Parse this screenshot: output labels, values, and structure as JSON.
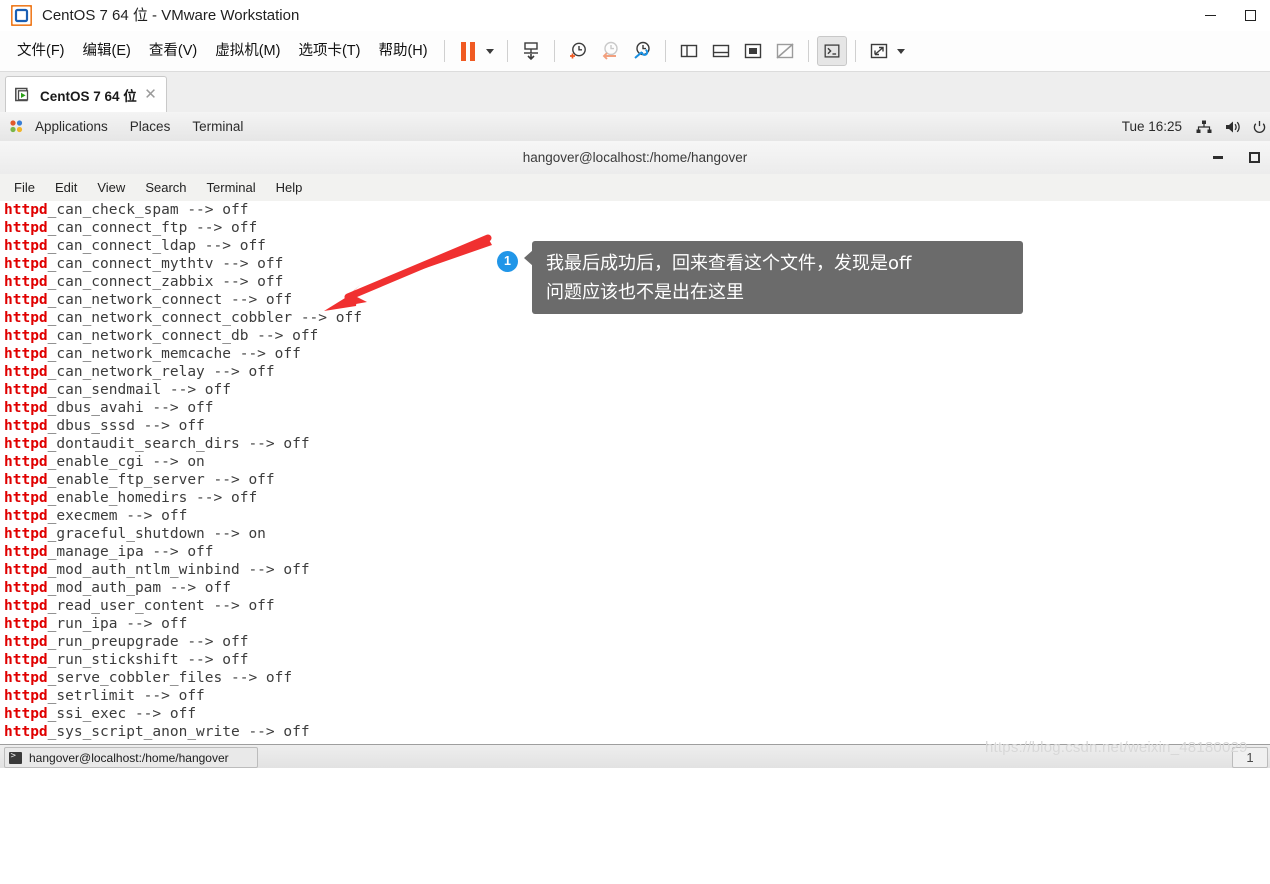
{
  "window": {
    "title": "CentOS 7 64 位 - VMware Workstation",
    "logo_icon": "vmware-logo-icon",
    "controls": [
      {
        "name": "minimize-button",
        "icon": "minimize-icon"
      },
      {
        "name": "maximize-button",
        "icon": "maximize-icon"
      }
    ]
  },
  "menubar": {
    "items": [
      {
        "label": "文件(F)",
        "name": "menu-file"
      },
      {
        "label": "编辑(E)",
        "name": "menu-edit"
      },
      {
        "label": "查看(V)",
        "name": "menu-view"
      },
      {
        "label": "虚拟机(M)",
        "name": "menu-vm"
      },
      {
        "label": "选项卡(T)",
        "name": "menu-tabs"
      },
      {
        "label": "帮助(H)",
        "name": "menu-help"
      }
    ],
    "toolbar": [
      {
        "name": "suspend-button",
        "icon": "pause-icon"
      },
      {
        "name": "power-dropdown",
        "icon": "chevron-down-icon"
      },
      {
        "name": "send-ctrl-alt-del-button",
        "icon": "send-keys-icon"
      },
      {
        "name": "take-snapshot-button",
        "icon": "snapshot-add-icon"
      },
      {
        "name": "revert-snapshot-button",
        "icon": "snapshot-revert-icon"
      },
      {
        "name": "snapshot-manager-button",
        "icon": "snapshot-manager-icon"
      },
      {
        "name": "show-library-button",
        "icon": "panel-left-icon"
      },
      {
        "name": "show-thumbnails-button",
        "icon": "panel-bottom-icon"
      },
      {
        "name": "show-console-button",
        "icon": "console-view-icon"
      },
      {
        "name": "hide-console-button",
        "icon": "console-hidden-icon"
      },
      {
        "name": "unity-mode-button",
        "icon": "terminal-prompt-icon"
      },
      {
        "name": "fullscreen-button",
        "icon": "fullscreen-icon"
      },
      {
        "name": "fullscreen-dropdown",
        "icon": "chevron-down-icon"
      }
    ]
  },
  "tabstrip": {
    "tab": {
      "label": "CentOS 7 64 位",
      "icon": "vm-running-icon",
      "close_icon": "close-icon",
      "close_glyph": "✕"
    }
  },
  "gnome_panel": {
    "activities_icon": "gnome-foot-icon",
    "items": [
      "Applications",
      "Places",
      "Terminal"
    ],
    "clock": "Tue 16:25",
    "tray": [
      {
        "name": "network-icon",
        "icon": "network-icon"
      },
      {
        "name": "volume-icon",
        "icon": "volume-icon"
      },
      {
        "name": "system-menu-icon",
        "icon": "power-icon"
      }
    ]
  },
  "terminal": {
    "title": "hangover@localhost:/home/hangover",
    "window_buttons": [
      {
        "name": "terminal-minimize-button",
        "icon": "minimize-icon"
      },
      {
        "name": "terminal-maximize-button",
        "icon": "maximize-icon"
      }
    ],
    "menu": [
      "File",
      "Edit",
      "View",
      "Search",
      "Terminal",
      "Help"
    ],
    "prefix": "httpd",
    "lines": [
      {
        "prefix": "httpd",
        "rest": "_can_check_spam --> off"
      },
      {
        "prefix": "httpd",
        "rest": "_can_connect_ftp --> off"
      },
      {
        "prefix": "httpd",
        "rest": "_can_connect_ldap --> off"
      },
      {
        "prefix": "httpd",
        "rest": "_can_connect_mythtv --> off"
      },
      {
        "prefix": "httpd",
        "rest": "_can_connect_zabbix --> off"
      },
      {
        "prefix": "httpd",
        "rest": "_can_network_connect --> off"
      },
      {
        "prefix": "httpd",
        "rest": "_can_network_connect_cobbler --> off"
      },
      {
        "prefix": "httpd",
        "rest": "_can_network_connect_db --> off"
      },
      {
        "prefix": "httpd",
        "rest": "_can_network_memcache --> off"
      },
      {
        "prefix": "httpd",
        "rest": "_can_network_relay --> off"
      },
      {
        "prefix": "httpd",
        "rest": "_can_sendmail --> off"
      },
      {
        "prefix": "httpd",
        "rest": "_dbus_avahi --> off"
      },
      {
        "prefix": "httpd",
        "rest": "_dbus_sssd --> off"
      },
      {
        "prefix": "httpd",
        "rest": "_dontaudit_search_dirs --> off"
      },
      {
        "prefix": "httpd",
        "rest": "_enable_cgi --> on"
      },
      {
        "prefix": "httpd",
        "rest": "_enable_ftp_server --> off"
      },
      {
        "prefix": "httpd",
        "rest": "_enable_homedirs --> off"
      },
      {
        "prefix": "httpd",
        "rest": "_execmem --> off"
      },
      {
        "prefix": "httpd",
        "rest": "_graceful_shutdown --> on"
      },
      {
        "prefix": "httpd",
        "rest": "_manage_ipa --> off"
      },
      {
        "prefix": "httpd",
        "rest": "_mod_auth_ntlm_winbind --> off"
      },
      {
        "prefix": "httpd",
        "rest": "_mod_auth_pam --> off"
      },
      {
        "prefix": "httpd",
        "rest": "_read_user_content --> off"
      },
      {
        "prefix": "httpd",
        "rest": "_run_ipa --> off"
      },
      {
        "prefix": "httpd",
        "rest": "_run_preupgrade --> off"
      },
      {
        "prefix": "httpd",
        "rest": "_run_stickshift --> off"
      },
      {
        "prefix": "httpd",
        "rest": "_serve_cobbler_files --> off"
      },
      {
        "prefix": "httpd",
        "rest": "_setrlimit --> off"
      },
      {
        "prefix": "httpd",
        "rest": "_ssi_exec --> off"
      },
      {
        "prefix": "httpd",
        "rest": "_sys_script_anon_write --> off"
      }
    ]
  },
  "taskbar": {
    "task_label": "hangover@localhost:/home/hangover",
    "task_icon": "terminal-icon",
    "workspace_count": "1"
  },
  "annotation": {
    "badge": "1",
    "line1": "我最后成功后，回来查看这个文件，发现是off",
    "line2": "问题应该也不是出在这里",
    "arrow_color": "#f03030",
    "badge_color": "#2196e8",
    "box_color": "#6b6b6b"
  },
  "watermark": "https://blog.csdn.net/weixin_48180029"
}
